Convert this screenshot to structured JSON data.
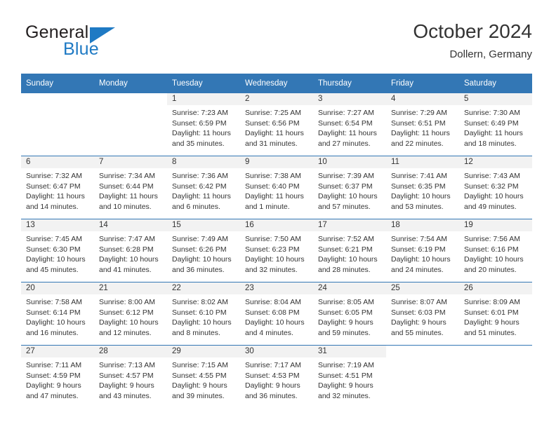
{
  "brand": {
    "word_one": "General",
    "word_two": "Blue",
    "flag_icon": "triangle-flag-icon",
    "brand_color": "#1f7ac4"
  },
  "header": {
    "title": "October 2024",
    "subtitle": "Dollern, Germany"
  },
  "theme": {
    "header_blue": "#3377b5",
    "daynum_band": "#f2f2f2",
    "text": "#333333"
  },
  "calendar": {
    "weekday_headers": [
      "Sunday",
      "Monday",
      "Tuesday",
      "Wednesday",
      "Thursday",
      "Friday",
      "Saturday"
    ],
    "weeks": [
      [
        {
          "day": "",
          "lines": []
        },
        {
          "day": "",
          "lines": []
        },
        {
          "day": "1",
          "lines": [
            "Sunrise: 7:23 AM",
            "Sunset: 6:59 PM",
            "Daylight: 11 hours",
            "and 35 minutes."
          ]
        },
        {
          "day": "2",
          "lines": [
            "Sunrise: 7:25 AM",
            "Sunset: 6:56 PM",
            "Daylight: 11 hours",
            "and 31 minutes."
          ]
        },
        {
          "day": "3",
          "lines": [
            "Sunrise: 7:27 AM",
            "Sunset: 6:54 PM",
            "Daylight: 11 hours",
            "and 27 minutes."
          ]
        },
        {
          "day": "4",
          "lines": [
            "Sunrise: 7:29 AM",
            "Sunset: 6:51 PM",
            "Daylight: 11 hours",
            "and 22 minutes."
          ]
        },
        {
          "day": "5",
          "lines": [
            "Sunrise: 7:30 AM",
            "Sunset: 6:49 PM",
            "Daylight: 11 hours",
            "and 18 minutes."
          ]
        }
      ],
      [
        {
          "day": "6",
          "lines": [
            "Sunrise: 7:32 AM",
            "Sunset: 6:47 PM",
            "Daylight: 11 hours",
            "and 14 minutes."
          ]
        },
        {
          "day": "7",
          "lines": [
            "Sunrise: 7:34 AM",
            "Sunset: 6:44 PM",
            "Daylight: 11 hours",
            "and 10 minutes."
          ]
        },
        {
          "day": "8",
          "lines": [
            "Sunrise: 7:36 AM",
            "Sunset: 6:42 PM",
            "Daylight: 11 hours",
            "and 6 minutes."
          ]
        },
        {
          "day": "9",
          "lines": [
            "Sunrise: 7:38 AM",
            "Sunset: 6:40 PM",
            "Daylight: 11 hours",
            "and 1 minute."
          ]
        },
        {
          "day": "10",
          "lines": [
            "Sunrise: 7:39 AM",
            "Sunset: 6:37 PM",
            "Daylight: 10 hours",
            "and 57 minutes."
          ]
        },
        {
          "day": "11",
          "lines": [
            "Sunrise: 7:41 AM",
            "Sunset: 6:35 PM",
            "Daylight: 10 hours",
            "and 53 minutes."
          ]
        },
        {
          "day": "12",
          "lines": [
            "Sunrise: 7:43 AM",
            "Sunset: 6:32 PM",
            "Daylight: 10 hours",
            "and 49 minutes."
          ]
        }
      ],
      [
        {
          "day": "13",
          "lines": [
            "Sunrise: 7:45 AM",
            "Sunset: 6:30 PM",
            "Daylight: 10 hours",
            "and 45 minutes."
          ]
        },
        {
          "day": "14",
          "lines": [
            "Sunrise: 7:47 AM",
            "Sunset: 6:28 PM",
            "Daylight: 10 hours",
            "and 41 minutes."
          ]
        },
        {
          "day": "15",
          "lines": [
            "Sunrise: 7:49 AM",
            "Sunset: 6:26 PM",
            "Daylight: 10 hours",
            "and 36 minutes."
          ]
        },
        {
          "day": "16",
          "lines": [
            "Sunrise: 7:50 AM",
            "Sunset: 6:23 PM",
            "Daylight: 10 hours",
            "and 32 minutes."
          ]
        },
        {
          "day": "17",
          "lines": [
            "Sunrise: 7:52 AM",
            "Sunset: 6:21 PM",
            "Daylight: 10 hours",
            "and 28 minutes."
          ]
        },
        {
          "day": "18",
          "lines": [
            "Sunrise: 7:54 AM",
            "Sunset: 6:19 PM",
            "Daylight: 10 hours",
            "and 24 minutes."
          ]
        },
        {
          "day": "19",
          "lines": [
            "Sunrise: 7:56 AM",
            "Sunset: 6:16 PM",
            "Daylight: 10 hours",
            "and 20 minutes."
          ]
        }
      ],
      [
        {
          "day": "20",
          "lines": [
            "Sunrise: 7:58 AM",
            "Sunset: 6:14 PM",
            "Daylight: 10 hours",
            "and 16 minutes."
          ]
        },
        {
          "day": "21",
          "lines": [
            "Sunrise: 8:00 AM",
            "Sunset: 6:12 PM",
            "Daylight: 10 hours",
            "and 12 minutes."
          ]
        },
        {
          "day": "22",
          "lines": [
            "Sunrise: 8:02 AM",
            "Sunset: 6:10 PM",
            "Daylight: 10 hours",
            "and 8 minutes."
          ]
        },
        {
          "day": "23",
          "lines": [
            "Sunrise: 8:04 AM",
            "Sunset: 6:08 PM",
            "Daylight: 10 hours",
            "and 4 minutes."
          ]
        },
        {
          "day": "24",
          "lines": [
            "Sunrise: 8:05 AM",
            "Sunset: 6:05 PM",
            "Daylight: 9 hours",
            "and 59 minutes."
          ]
        },
        {
          "day": "25",
          "lines": [
            "Sunrise: 8:07 AM",
            "Sunset: 6:03 PM",
            "Daylight: 9 hours",
            "and 55 minutes."
          ]
        },
        {
          "day": "26",
          "lines": [
            "Sunrise: 8:09 AM",
            "Sunset: 6:01 PM",
            "Daylight: 9 hours",
            "and 51 minutes."
          ]
        }
      ],
      [
        {
          "day": "27",
          "lines": [
            "Sunrise: 7:11 AM",
            "Sunset: 4:59 PM",
            "Daylight: 9 hours",
            "and 47 minutes."
          ]
        },
        {
          "day": "28",
          "lines": [
            "Sunrise: 7:13 AM",
            "Sunset: 4:57 PM",
            "Daylight: 9 hours",
            "and 43 minutes."
          ]
        },
        {
          "day": "29",
          "lines": [
            "Sunrise: 7:15 AM",
            "Sunset: 4:55 PM",
            "Daylight: 9 hours",
            "and 39 minutes."
          ]
        },
        {
          "day": "30",
          "lines": [
            "Sunrise: 7:17 AM",
            "Sunset: 4:53 PM",
            "Daylight: 9 hours",
            "and 36 minutes."
          ]
        },
        {
          "day": "31",
          "lines": [
            "Sunrise: 7:19 AM",
            "Sunset: 4:51 PM",
            "Daylight: 9 hours",
            "and 32 minutes."
          ]
        },
        {
          "day": "",
          "lines": []
        },
        {
          "day": "",
          "lines": []
        }
      ]
    ]
  }
}
